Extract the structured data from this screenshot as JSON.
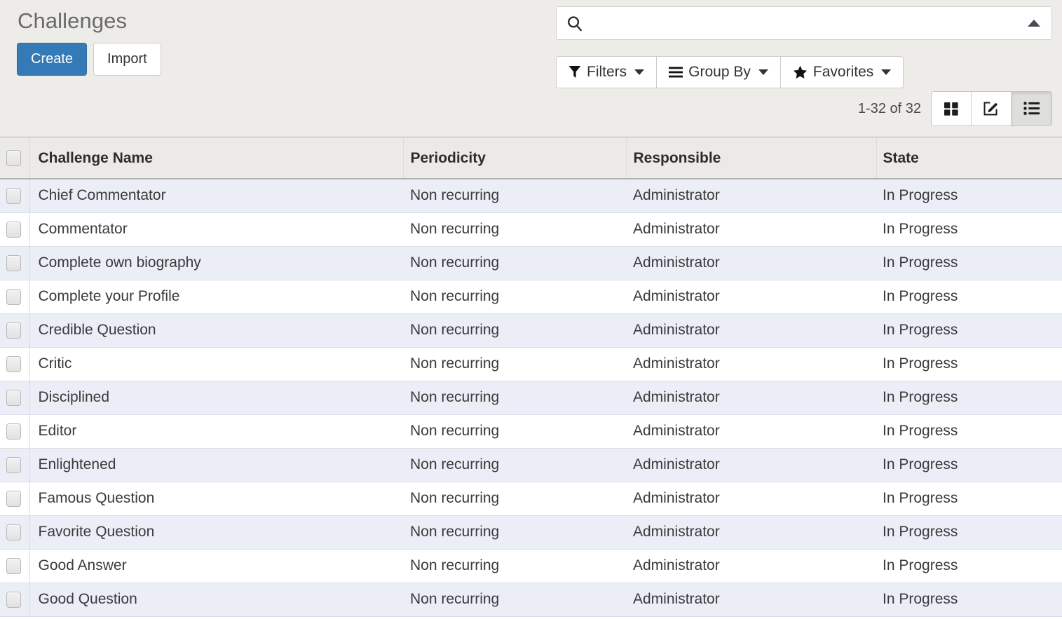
{
  "header": {
    "page_title": "Challenges",
    "create_label": "Create",
    "import_label": "Import"
  },
  "search": {
    "value": "",
    "placeholder": "",
    "icon": "search-icon",
    "toggle_icon": "caret-up-icon"
  },
  "filter_bar": {
    "filters_label": "Filters",
    "filters_icon": "funnel-icon",
    "group_by_label": "Group By",
    "group_by_icon": "bars-icon",
    "favorites_label": "Favorites",
    "favorites_icon": "star-icon"
  },
  "pager": {
    "range_text": "1-32 of 32"
  },
  "view_switcher": {
    "views": [
      {
        "name": "kanban-view",
        "icon": "grid-icon",
        "active": false
      },
      {
        "name": "form-view",
        "icon": "pencil-square-icon",
        "active": false
      },
      {
        "name": "list-view",
        "icon": "list-icon",
        "active": true
      }
    ]
  },
  "table": {
    "columns": [
      "Challenge Name",
      "Periodicity",
      "Responsible",
      "State"
    ],
    "rows": [
      {
        "name": "Chief Commentator",
        "periodicity": "Non recurring",
        "responsible": "Administrator",
        "state": "In Progress"
      },
      {
        "name": "Commentator",
        "periodicity": "Non recurring",
        "responsible": "Administrator",
        "state": "In Progress"
      },
      {
        "name": "Complete own biography",
        "periodicity": "Non recurring",
        "responsible": "Administrator",
        "state": "In Progress"
      },
      {
        "name": "Complete your Profile",
        "periodicity": "Non recurring",
        "responsible": "Administrator",
        "state": "In Progress"
      },
      {
        "name": "Credible Question",
        "periodicity": "Non recurring",
        "responsible": "Administrator",
        "state": "In Progress"
      },
      {
        "name": "Critic",
        "periodicity": "Non recurring",
        "responsible": "Administrator",
        "state": "In Progress"
      },
      {
        "name": "Disciplined",
        "periodicity": "Non recurring",
        "responsible": "Administrator",
        "state": "In Progress"
      },
      {
        "name": "Editor",
        "periodicity": "Non recurring",
        "responsible": "Administrator",
        "state": "In Progress"
      },
      {
        "name": "Enlightened",
        "periodicity": "Non recurring",
        "responsible": "Administrator",
        "state": "In Progress"
      },
      {
        "name": "Famous Question",
        "periodicity": "Non recurring",
        "responsible": "Administrator",
        "state": "In Progress"
      },
      {
        "name": "Favorite Question",
        "periodicity": "Non recurring",
        "responsible": "Administrator",
        "state": "In Progress"
      },
      {
        "name": "Good Answer",
        "periodicity": "Non recurring",
        "responsible": "Administrator",
        "state": "In Progress"
      },
      {
        "name": "Good Question",
        "periodicity": "Non recurring",
        "responsible": "Administrator",
        "state": "In Progress"
      }
    ]
  },
  "colors": {
    "primary": "#337ab7",
    "panel_bg": "#edece8",
    "row_stripe": "#eceef7",
    "header_bg": "#ebeae6",
    "title_text": "#6a6a6a"
  }
}
